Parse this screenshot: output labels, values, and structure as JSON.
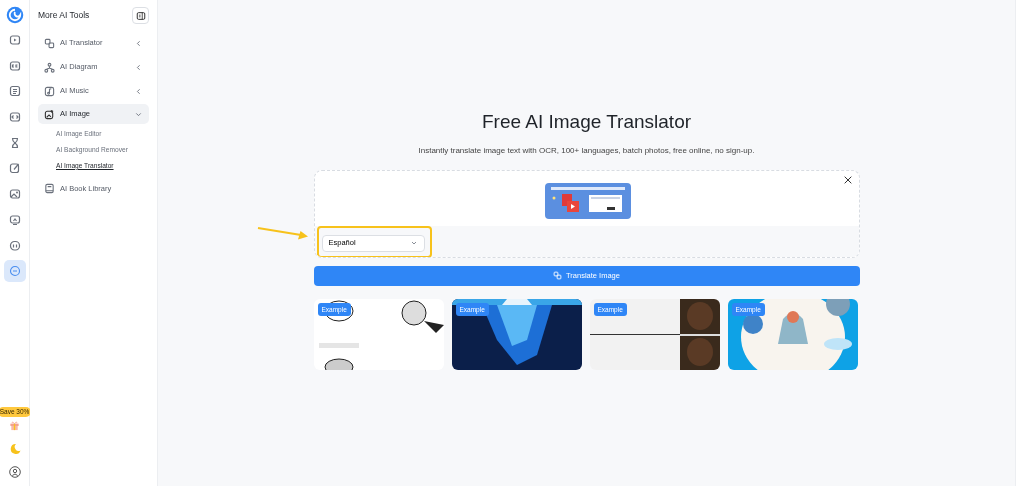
{
  "rail": {
    "items": [
      {
        "selected": false
      },
      {
        "selected": false
      },
      {
        "selected": false
      },
      {
        "selected": false
      },
      {
        "selected": false
      },
      {
        "selected": false
      },
      {
        "selected": false
      },
      {
        "selected": false
      },
      {
        "selected": false
      },
      {
        "selected": true
      }
    ],
    "promo": "Save 30%"
  },
  "sidebar": {
    "title": "More AI Tools",
    "items": [
      {
        "label": "AI Translator",
        "expanded": false,
        "selected": false
      },
      {
        "label": "AI Diagram",
        "expanded": false,
        "selected": false
      },
      {
        "label": "AI Music",
        "expanded": false,
        "selected": false
      },
      {
        "label": "AI Image",
        "expanded": true,
        "selected": true,
        "children": [
          {
            "label": "AI Image Editor",
            "selected": false
          },
          {
            "label": "AI Background Remover",
            "selected": false
          },
          {
            "label": "AI Image Translator",
            "selected": true
          }
        ]
      },
      {
        "label": "AI Book Library",
        "selected": false
      }
    ]
  },
  "main": {
    "title": "Free AI Image Translator",
    "subtitle": "Instantly translate image text with OCR, 100+ languages, batch photos, free online, no sign-up.",
    "upload": {
      "kind": "picture",
      "language": "Español"
    },
    "button": "Translate Image",
    "examples": [
      {
        "badge": "Example",
        "kind": "picture"
      },
      {
        "badge": "Example",
        "kind": "picture"
      },
      {
        "badge": "Example",
        "kind": "picture"
      },
      {
        "badge": "Example",
        "kind": "picture"
      }
    ]
  }
}
